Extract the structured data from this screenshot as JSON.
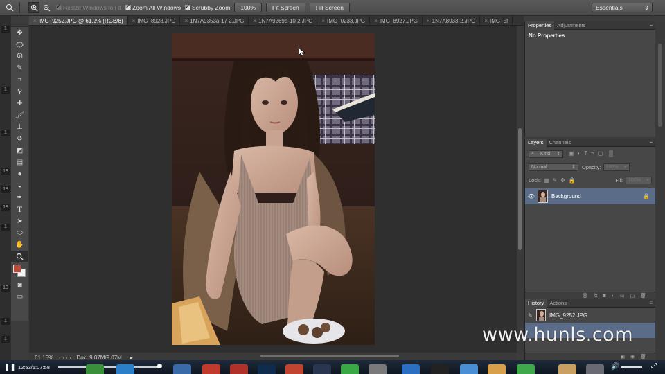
{
  "options_bar": {
    "resize_windows": "Resize Windows to Fit",
    "zoom_all": "Zoom All Windows",
    "scrubby_zoom": "Scrubby Zoom",
    "zoom_value": "100%",
    "fit_screen": "Fit Screen",
    "fill_screen": "Fill Screen",
    "workspace": "Essentials"
  },
  "ruler_marks": [
    "1",
    "1",
    "1",
    "18",
    "18",
    "18",
    "1",
    "18",
    "1",
    "1"
  ],
  "tabs": [
    {
      "label": "IMG_9252.JPG @ 61.2% (RGB/8)",
      "active": true
    },
    {
      "label": "IMG_8928.JPG",
      "active": false
    },
    {
      "label": "1N7A9353a-17 2.JPG",
      "active": false
    },
    {
      "label": "1N7A9269a-10 2.JPG",
      "active": false
    },
    {
      "label": "IMG_0233.JPG",
      "active": false
    },
    {
      "label": "IMG_8927.JPG",
      "active": false
    },
    {
      "label": "1N7A8933-2.JPG",
      "active": false
    },
    {
      "label": "IMG_5I",
      "active": false
    }
  ],
  "status": {
    "zoom": "61.15%",
    "doc": "Doc: 9.07M/9.07M"
  },
  "properties_panel": {
    "tab_properties": "Properties",
    "tab_adjustments": "Adjustments",
    "content": "No Properties"
  },
  "layers_panel": {
    "tab_layers": "Layers",
    "tab_channels": "Channels",
    "kind": "Kind",
    "blend_mode": "Normal",
    "opacity_label": "Opacity:",
    "opacity_value": "100%",
    "lock_label": "Lock:",
    "fill_label": "Fill:",
    "fill_value": "100%",
    "layer_name": "Background"
  },
  "history_panel": {
    "tab_history": "History",
    "tab_actions": "Actions",
    "snapshot": "IMG_9252.JPG"
  },
  "watermark": "www.hunls.com",
  "player": {
    "time": "12:53/1:07:58",
    "progress": 0.19
  },
  "colors": {
    "foreground": "#b84a36",
    "background": "#f4f4f4",
    "selection": "#5b6c88"
  }
}
